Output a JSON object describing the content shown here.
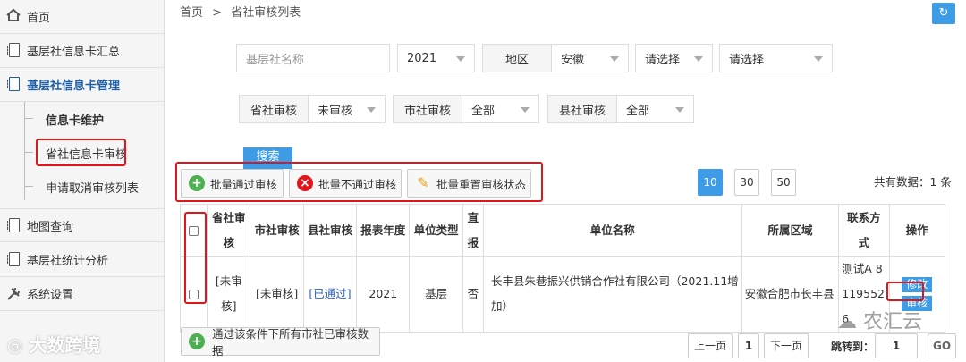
{
  "sidebar": {
    "home": "首页",
    "info_summary": "基层社信息卡汇总",
    "info_manage": "基层社信息卡管理",
    "sub_maintain": "信息卡维护",
    "sub_prov_review": "省社信息卡审核",
    "sub_cancel_list": "申请取消审核列表",
    "map_query": "地图查询",
    "stats": "基层社统计分析",
    "settings": "系统设置",
    "watermark": "大数跨境"
  },
  "breadcrumb": {
    "home": "首页",
    "sep": ">",
    "current": "省社审核列表"
  },
  "refresh_icon": "refresh-icon",
  "filters": {
    "name_placeholder": "基层社名称",
    "year": "2021",
    "region_label": "地区",
    "province": "安徽",
    "city": "请选择",
    "county": "请选择",
    "prov_review_label": "省社审核",
    "prov_review_value": "未审核",
    "city_review_label": "市社审核",
    "city_review_value": "全部",
    "county_review_label": "县社审核",
    "county_review_value": "全部",
    "search": "搜索"
  },
  "actions": {
    "batch_pass": "批量通过审核",
    "batch_reject": "批量不通过审核",
    "batch_reset": "批量重置审核状态"
  },
  "page_size": {
    "options": [
      "10",
      "30",
      "50"
    ],
    "selected": "10"
  },
  "total": "共有数据：1 条",
  "table": {
    "headers": [
      "省社审核",
      "市社审核",
      "县社审核",
      "报表年度",
      "单位类型",
      "直报",
      "单位名称",
      "所属区域",
      "联系方式",
      "操作"
    ],
    "rows": [
      {
        "prov": "[未审核]",
        "city": "[未审核]",
        "county": "[已通过]",
        "year": "2021",
        "type": "基层",
        "direct": "否",
        "name": "长丰县朱巷振兴供销合作社有限公司（2021.11增加）",
        "region": "安徽合肥市长丰县",
        "contact": "测试A 81195526",
        "edit": "修改",
        "review": "审核"
      }
    ]
  },
  "bottom": {
    "approve_all": "通过该条件下所有市社已审核数据",
    "prev": "上一页",
    "page": "1",
    "next": "下一页",
    "jump_label": "跳转到：",
    "jump_value": "1",
    "go": "GO",
    "watermark": "农汇云"
  },
  "colors": {
    "accent": "#3d9ce5",
    "highlight": "#e0161b",
    "active_menu": "#1e5fa8"
  }
}
